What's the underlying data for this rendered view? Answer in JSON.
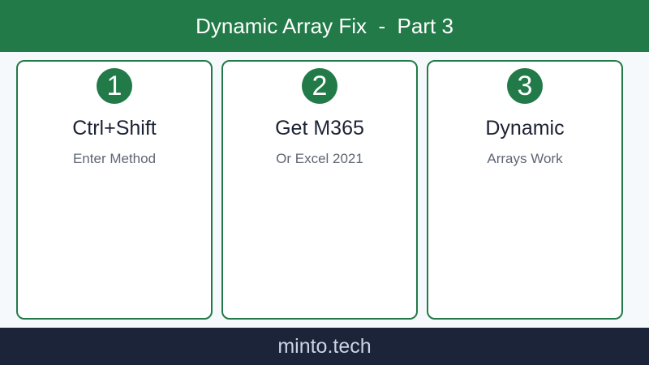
{
  "header": {
    "title": "Dynamic Array Fix  -  Part 3"
  },
  "cards": [
    {
      "number": "1",
      "title": "Ctrl+Shift",
      "subtitle": "Enter Method"
    },
    {
      "number": "2",
      "title": "Get M365",
      "subtitle": "Or Excel 2021"
    },
    {
      "number": "3",
      "title": "Dynamic",
      "subtitle": "Arrays Work"
    }
  ],
  "footer": {
    "text": "minto.tech"
  },
  "colors": {
    "accent_green": "#217a47",
    "footer_navy": "#1b2438",
    "background": "#f6f9fb"
  }
}
